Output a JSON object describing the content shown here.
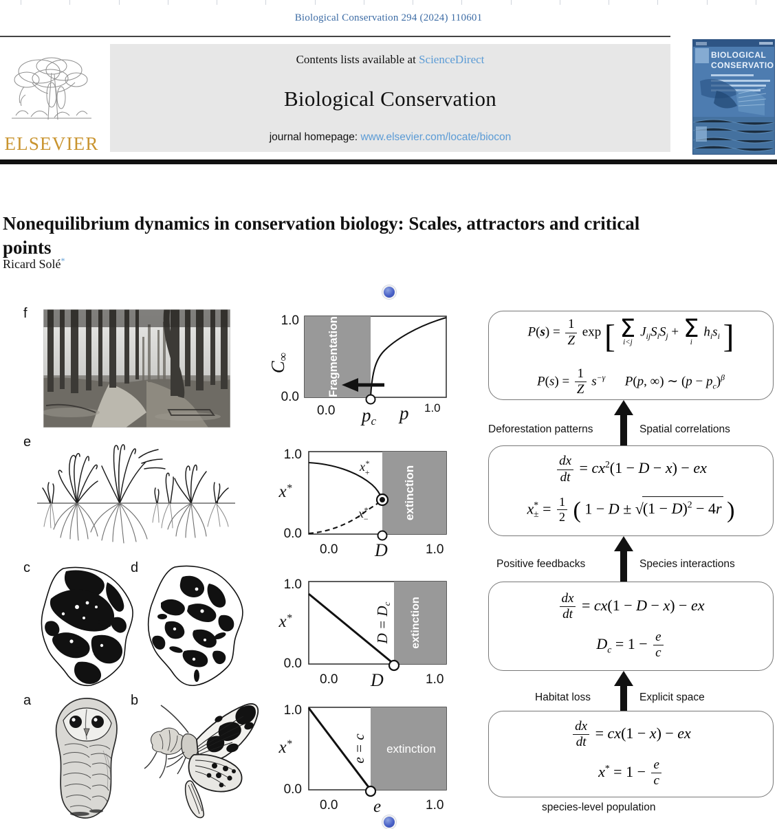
{
  "running_head": "Biological Conservation 294 (2024) 110601",
  "masthead": {
    "contents_prefix": "Contents lists available at ",
    "contents_link": "ScienceDirect",
    "journal_title": "Biological Conservation",
    "homepage_prefix": "journal homepage: ",
    "homepage_link": "www.elsevier.com/locate/biocon",
    "publisher": "ELSEVIER",
    "cover_title_line1": "BIOLOGICAL",
    "cover_title_line2": "CONSERVATION"
  },
  "article": {
    "title": "Nonequilibrium dynamics in conservation biology: Scales, attractors and critical points",
    "author": "Ricard Solé",
    "author_footnote_marker": "*"
  },
  "figure": {
    "panels": [
      {
        "letter": "f",
        "caption": "forest-interior photograph"
      },
      {
        "letter": "e",
        "caption": "grass tussocks with root systems"
      },
      {
        "letter": "c",
        "caption": "habitat fragmentation map (high cover)"
      },
      {
        "letter": "d",
        "caption": "habitat fragmentation map (low cover)"
      },
      {
        "letter": "a",
        "caption": "spotted owl illustration"
      },
      {
        "letter": "b",
        "caption": "butterfly illustration"
      }
    ],
    "nav_dot_color": "#4a62c8"
  },
  "chart_data": [
    {
      "id": "percolation",
      "type": "line",
      "title": "",
      "xlabel": "p",
      "ylabel": "C∞",
      "xticks": [
        "0.0",
        "p_c",
        "1.0"
      ],
      "yticks": [
        "0.0",
        "1.0"
      ],
      "xlim": [
        0,
        1
      ],
      "ylim": [
        0,
        1
      ],
      "shaded_region": {
        "label": "Fragmentation",
        "from": 0.0,
        "to": 0.45,
        "color": "#999999"
      },
      "critical_point": {
        "x": 0.45,
        "y": 0.0,
        "marker": "open-circle"
      },
      "annotation_arrow": "leftward arrow into shaded region",
      "series": [
        {
          "name": "C_infinity",
          "style": "solid",
          "x": [
            0.45,
            0.47,
            0.5,
            0.55,
            0.62,
            0.7,
            0.8,
            0.9,
            1.0
          ],
          "y": [
            0.0,
            0.28,
            0.42,
            0.57,
            0.7,
            0.8,
            0.9,
            0.96,
            1.02
          ]
        }
      ]
    },
    {
      "id": "saddle-node",
      "type": "line",
      "title": "",
      "xlabel": "D",
      "ylabel": "x*",
      "xticks": [
        "0.0",
        "1.0"
      ],
      "yticks": [
        "0.0",
        "1.0"
      ],
      "xlim": [
        0,
        1
      ],
      "ylim": [
        0,
        1
      ],
      "shaded_region": {
        "label": "extinction",
        "from": 0.53,
        "to": 1.0,
        "color": "#999999"
      },
      "critical_point": {
        "x": 0.53,
        "y": 0.42,
        "marker": "filled-circle-ring"
      },
      "extra_point": {
        "x": 0.53,
        "y": 0.0,
        "marker": "open-circle"
      },
      "series": [
        {
          "name": "x*_+",
          "style": "solid",
          "label": "x*+",
          "x": [
            0.0,
            0.1,
            0.2,
            0.3,
            0.4,
            0.47,
            0.53
          ],
          "y": [
            0.87,
            0.86,
            0.83,
            0.78,
            0.68,
            0.58,
            0.42
          ]
        },
        {
          "name": "x*_-",
          "style": "dashed",
          "label": "x*−",
          "x": [
            0.0,
            0.1,
            0.2,
            0.3,
            0.4,
            0.47,
            0.53
          ],
          "y": [
            0.0,
            0.02,
            0.06,
            0.12,
            0.21,
            0.29,
            0.42
          ]
        }
      ]
    },
    {
      "id": "transcritical-D",
      "type": "line",
      "title": "",
      "xlabel": "D",
      "ylabel": "x*",
      "xticks": [
        "0.0",
        "1.0"
      ],
      "yticks": [
        "0.0",
        "1.0"
      ],
      "xlim": [
        0,
        1
      ],
      "ylim": [
        0,
        1
      ],
      "shaded_region": {
        "label": "extinction",
        "from": 0.62,
        "to": 1.0,
        "color": "#999999"
      },
      "boundary_label": "D = Dс",
      "critical_point": {
        "x": 0.62,
        "y": 0.0,
        "marker": "open-circle"
      },
      "series": [
        {
          "name": "x*",
          "style": "solid",
          "x": [
            0.0,
            0.62
          ],
          "y": [
            0.8,
            0.0
          ]
        }
      ]
    },
    {
      "id": "transcritical-e",
      "type": "line",
      "title": "",
      "xlabel": "e",
      "ylabel": "x*",
      "xticks": [
        "0.0",
        "1.0"
      ],
      "yticks": [
        "0.0",
        "1.0"
      ],
      "xlim": [
        0,
        1
      ],
      "ylim": [
        0,
        1
      ],
      "shaded_region": {
        "label": "extinction",
        "from": 0.45,
        "to": 1.0,
        "color": "#999999"
      },
      "boundary_label": "e = c",
      "critical_point": {
        "x": 0.45,
        "y": 0.0,
        "marker": "open-circle"
      },
      "series": [
        {
          "name": "x*",
          "style": "solid",
          "x": [
            0.0,
            0.45
          ],
          "y": [
            1.0,
            0.0
          ]
        }
      ]
    }
  ],
  "flow": {
    "boxes": [
      {
        "id": "box-macro",
        "equations": [
          "P(s) = (1/Z) exp[ Σ_{i<j} J_ij S_i S_j + Σ_i h_i s_i ]",
          "P(s) = (1/Z) s^{-γ}        P(p,∞) ~ (p - p_c)^β"
        ]
      },
      {
        "id": "box-quadratic",
        "equations": [
          "dx/dt = c x^2 (1 - D - x) - e x",
          "x*_± = (1/2)( 1 - D ± sqrt((1-D)^2 - 4r) )"
        ]
      },
      {
        "id": "box-spatial",
        "equations": [
          "dx/dt = c x (1 - D - x) - e x",
          "D_c = 1 - e/c"
        ]
      },
      {
        "id": "box-levins",
        "equations": [
          "dx/dt = c x (1 - x) - e x",
          "x* = 1 - e/c"
        ]
      }
    ],
    "labels": [
      {
        "id": "deforestation-patterns",
        "text": "Deforestation patterns",
        "side": "left"
      },
      {
        "id": "spatial-correlations",
        "text": "Spatial correlations",
        "side": "right"
      },
      {
        "id": "positive-feedbacks",
        "text": "Positive feedbacks",
        "side": "left"
      },
      {
        "id": "species-interactions",
        "text": "Species interactions",
        "side": "right"
      },
      {
        "id": "habitat-loss",
        "text": "Habitat loss",
        "side": "left"
      },
      {
        "id": "explicit-space",
        "text": "Explicit space",
        "side": "right"
      },
      {
        "id": "species-level-population",
        "text": "species-level population",
        "side": "center"
      }
    ]
  }
}
